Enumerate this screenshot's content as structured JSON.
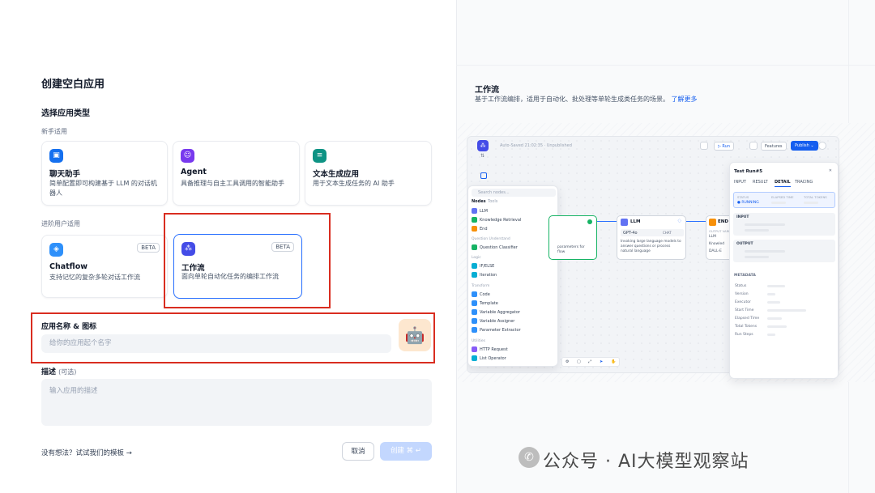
{
  "dialog": {
    "title": "创建空白应用",
    "type_section": "选择应用类型",
    "beginner_group": "新手适用",
    "advanced_group": "进阶用户适用",
    "cards_beginner": [
      {
        "name": "聊天助手",
        "desc": "简单配置即可构建基于 LLM 的对话机器人",
        "icon": "chat-bubble-icon",
        "color": "#1570ef"
      },
      {
        "name": "Agent",
        "desc": "具备推理与自主工具调用的智能助手",
        "icon": "agent-robot-icon",
        "color": "#7839ee"
      },
      {
        "name": "文本生成应用",
        "desc": "用于文本生成任务的 AI 助手",
        "icon": "text-generator-icon",
        "color": "#0e9384"
      }
    ],
    "cards_advanced": [
      {
        "name": "Chatflow",
        "desc": "支持记忆的复杂多轮对话工作流",
        "badge": "BETA",
        "icon": "chatflow-icon",
        "color": "#1570ef"
      },
      {
        "name": "工作流",
        "desc": "面向单轮自动化任务的编排工作流",
        "badge": "BETA",
        "icon": "workflow-icon",
        "color": "#444ce7",
        "selected": true
      }
    ],
    "name_label": "应用名称 & 图标",
    "name_placeholder": "给你的应用起个名字",
    "avatar": "🤖",
    "desc_label": "描述",
    "desc_optional": "(可选)",
    "desc_placeholder": "输入应用的描述",
    "template_link": "没有想法？试试我们的模板 →",
    "cancel": "取消",
    "create": "创建 ⌘ ↵"
  },
  "preview": {
    "title": "工作流",
    "desc": "基于工作流编排，适用于自动化、批处理等单轮生成类任务的场景。",
    "learn_more": "了解更多",
    "canvas": {
      "autosave": "Auto-Saved 21:02:35 · Unpublished",
      "run": "▷ Run",
      "features": "Features",
      "publish": "Publish ⌄",
      "search_placeholder": "Search nodes...",
      "tabs": [
        "Nodes",
        "Tools"
      ],
      "groups": [
        {
          "label": "",
          "items": [
            {
              "name": "LLM",
              "color": "#6172f3"
            },
            {
              "name": "Knowledge Retrieval",
              "color": "#16b364"
            },
            {
              "name": "End",
              "color": "#f79009"
            }
          ]
        },
        {
          "label": "Question Understand",
          "items": [
            {
              "name": "Question Classifier",
              "color": "#16b364"
            }
          ]
        },
        {
          "label": "Logic",
          "items": [
            {
              "name": "IF/ELSE",
              "color": "#06aed4"
            },
            {
              "name": "Iteration",
              "color": "#06aed4"
            }
          ]
        },
        {
          "label": "Transform",
          "items": [
            {
              "name": "Code",
              "color": "#2e90fa"
            },
            {
              "name": "Template",
              "color": "#2e90fa"
            },
            {
              "name": "Variable Aggregator",
              "color": "#2e90fa"
            },
            {
              "name": "Variable Assigner",
              "color": "#2e90fa"
            },
            {
              "name": "Parameter Extractor",
              "color": "#2e90fa"
            }
          ]
        },
        {
          "label": "Utilities",
          "items": [
            {
              "name": "HTTP Request",
              "color": "#875bf7"
            },
            {
              "name": "List Operator",
              "color": "#06aed4"
            }
          ]
        }
      ],
      "llm_node": {
        "title": "LLM",
        "model": "GPT-4o",
        "mode": "CHAT",
        "desc": "Invoking large language models to answer questions or process natural language"
      },
      "partial_node_text": "parameters for flow",
      "end_node": {
        "title": "END",
        "output_label": "OUTPUT VARI",
        "items": [
          "LLM",
          "Knowled",
          "DALL-E"
        ]
      },
      "run_panel": {
        "title": "Test Run#5",
        "tabs": [
          "INPUT",
          "RESULT",
          "DETAIL",
          "TRACING"
        ],
        "active_tab": "DETAIL",
        "status_label": "STATUS",
        "status_value": "● RUNNING",
        "elapsed_label": "ELAPSED TIME",
        "tokens_label": "TOTAL TOKENS",
        "input_label": "INPUT",
        "output_label": "OUTPUT",
        "metadata_label": "METADATA",
        "meta_rows": [
          "Status",
          "Version",
          "Executor",
          "Start Time",
          "Elapsed Time",
          "Total Tokens",
          "Run Steps"
        ]
      }
    }
  },
  "watermark": "公众号 · AI大模型观察站"
}
